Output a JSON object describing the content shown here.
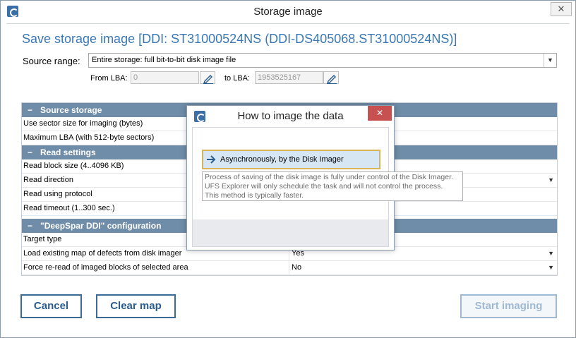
{
  "window": {
    "title": "Storage image",
    "close_glyph": "✕"
  },
  "heading": "Save storage image [DDI: ST31000524NS (DDI-DS405068.ST31000524NS)]",
  "source_range": {
    "label": "Source range:",
    "value": "Entire storage: full bit-to-bit disk image file",
    "arrow": "▼"
  },
  "lba": {
    "from_label": "From LBA:",
    "from_value": "0",
    "to_label": "to LBA:",
    "to_value": "1953525167"
  },
  "grid": {
    "group1": {
      "minus": "−",
      "title": "Source storage"
    },
    "group1_rows": [
      {
        "name": "Use sector size for imaging (bytes)",
        "value": ""
      },
      {
        "name": "Maximum LBA (with 512-byte sectors)",
        "value": ""
      }
    ],
    "group2": {
      "minus": "−",
      "title": "Read settings"
    },
    "group2_rows": [
      {
        "name": "Read block size (4..4096 KB)",
        "value": ""
      },
      {
        "name": "Read direction",
        "value": ""
      },
      {
        "name": "Read using protocol",
        "value": ""
      },
      {
        "name": "Read timeout (1..300 sec.)",
        "value": ""
      }
    ],
    "group3": {
      "minus": "−",
      "title": "\"DeepSpar DDI\" configuration"
    },
    "group3_rows": [
      {
        "name": "Target type",
        "value": ""
      },
      {
        "name": "Load existing map of defects from disk imager",
        "value": "Yes"
      },
      {
        "name": "Force re-read of imaged blocks of selected area",
        "value": "No"
      }
    ],
    "dropdown_glyph": "▼"
  },
  "buttons": {
    "cancel": "Cancel",
    "clear_map": "Clear map",
    "start_imaging": "Start imaging"
  },
  "dialog": {
    "title": "How to image the data",
    "close_glyph": "✕",
    "option": "Asynchronously, by the Disk Imager",
    "tooltip": [
      "Process of saving of the disk image is fully under control of the Disk Imager.",
      "UFS Explorer will only schedule the task and will not control the process.",
      "This method is typically faster."
    ]
  },
  "colors": {
    "heading": "#3a78b5",
    "group_header": "#6f8da8",
    "button_border": "#3b6a97",
    "dialog_close": "#c75050",
    "option_highlight": "#d6e6f3"
  }
}
